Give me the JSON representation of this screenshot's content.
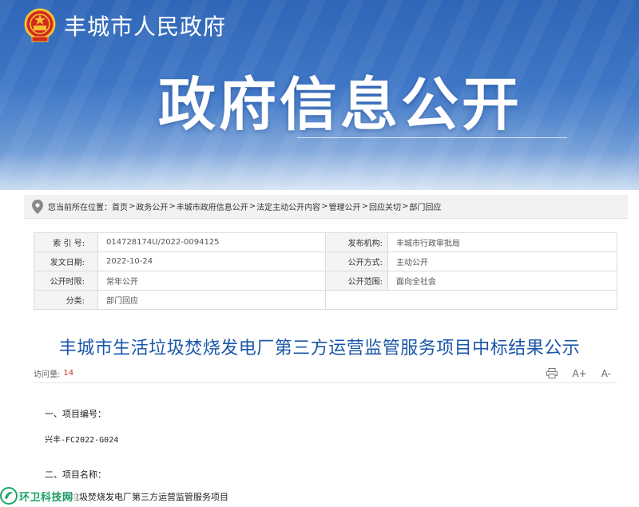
{
  "header": {
    "site_name": "丰城市人民政府",
    "banner_title": "政府信息公开"
  },
  "breadcrumb": {
    "prefix": "您当前所在位置：",
    "items": [
      "首页",
      "政务公开",
      "丰城市政府信息公开",
      "法定主动公开内容",
      "管理公开",
      "回应关切",
      "部门回应"
    ],
    "separator": ">"
  },
  "info": {
    "index_label": "索 引 号:",
    "index_value": "014728174U/2022-0094125",
    "publisher_label": "发布机构:",
    "publisher_value": "丰城市行政审批局",
    "date_label": "发文日期:",
    "date_value": "2022-10-24",
    "mode_label": "公开方式:",
    "mode_value": "主动公开",
    "period_label": "公开时限:",
    "period_value": "常年公开",
    "scope_label": "公开范围:",
    "scope_value": "面向全社会",
    "category_label": "分类:",
    "category_value": "部门回应"
  },
  "article": {
    "title": "丰城市生活垃圾焚烧发电厂第三方运营监管服务项目中标结果公示",
    "views_label": "访问量:",
    "views_count": "14",
    "font_increase": "A+",
    "font_decrease": "A-",
    "paragraphs": [
      "一、项目编号：",
      "兴丰-FC2022-G024",
      "二、项目名称：",
      "生活垃圾焚烧发电厂第三方运营监管服务项目"
    ]
  },
  "watermark": {
    "text": "环卫科技网"
  },
  "colors": {
    "banner_blue": "#2f66b7",
    "title_blue": "#1a57a8",
    "count_red": "#c0392b",
    "watermark_green": "#1fa36b"
  }
}
